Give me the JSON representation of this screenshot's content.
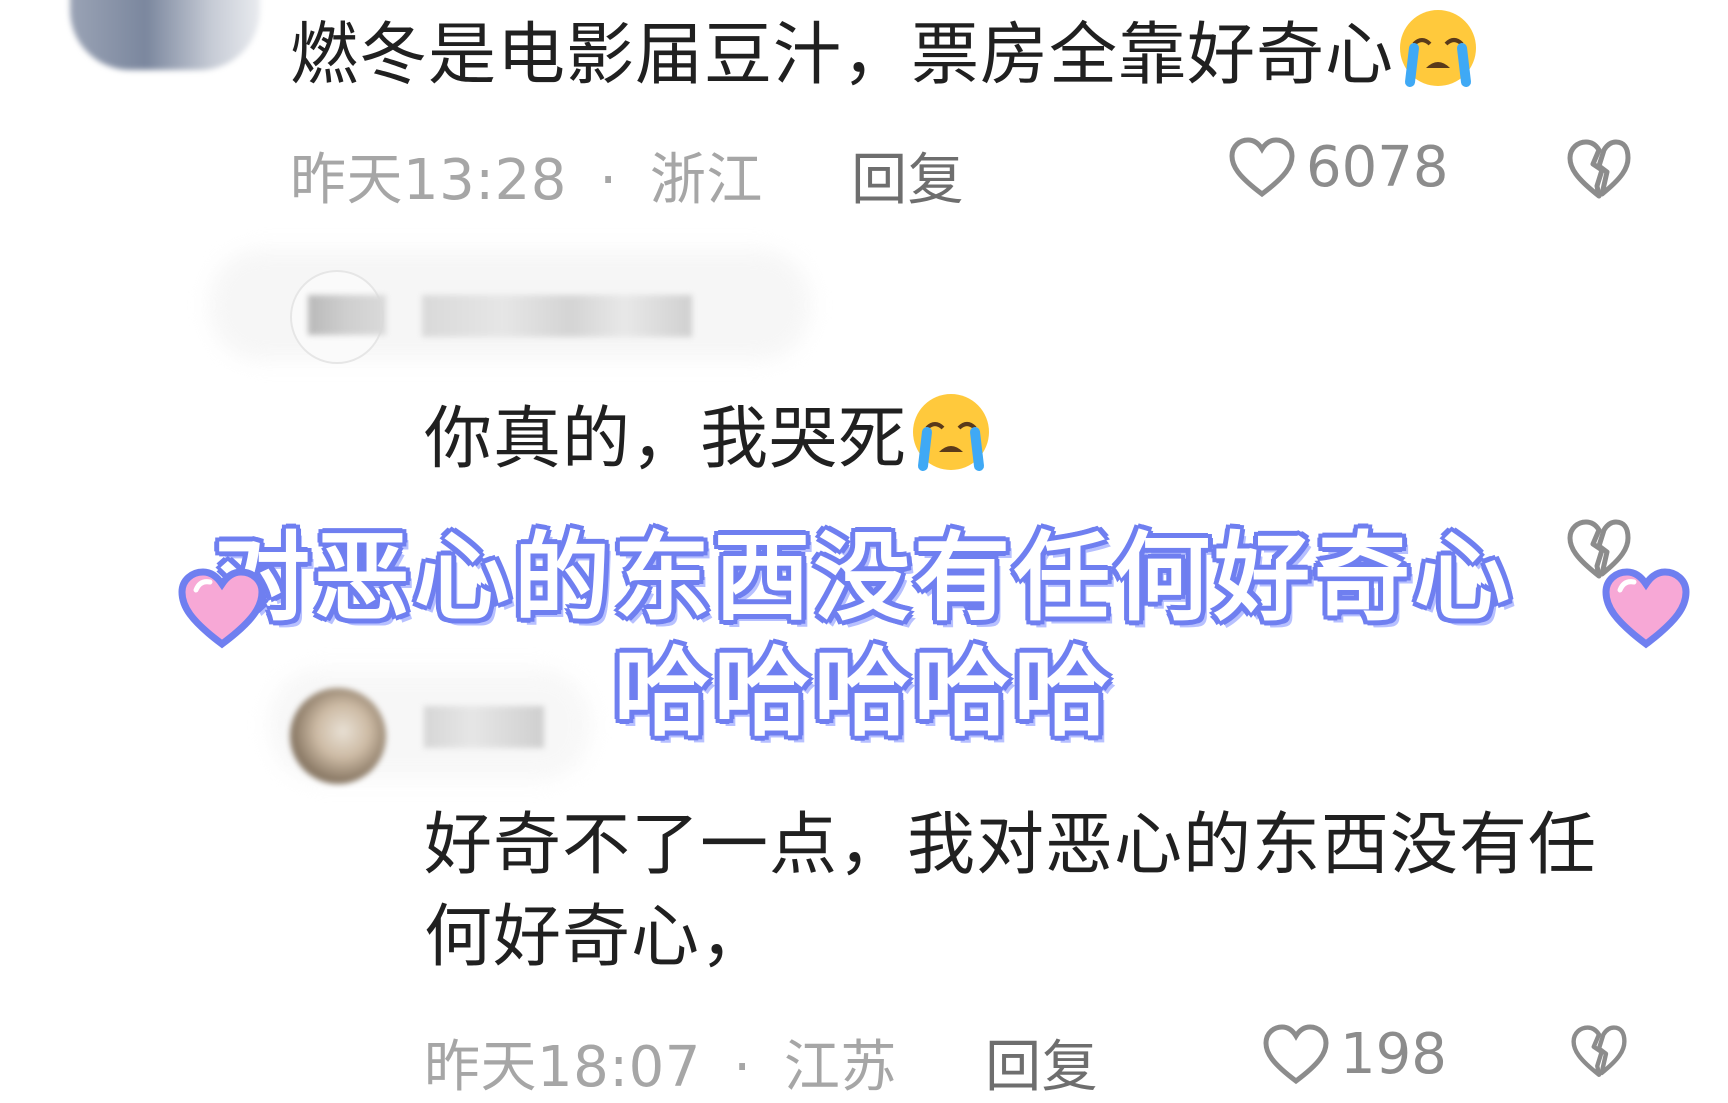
{
  "comments": [
    {
      "text": "燃冬是电影届豆汁，票房全靠好奇心",
      "emoji": "loudly-crying-emoji",
      "time": "昨天13:28",
      "separator": "·",
      "location": "浙江",
      "reply_label": "回复",
      "likes": "6078"
    },
    {
      "text": "你真的，我哭死",
      "emoji": "loudly-crying-emoji"
    },
    {
      "text": "好奇不了一点，我对恶心的东西没有任何好奇心，",
      "time": "昨天18:07",
      "separator": "·",
      "location": "江苏",
      "reply_label": "回复",
      "likes": "198"
    }
  ],
  "overlay": {
    "line1": "对恶心的东西没有任何好奇心",
    "line2": "哈哈哈哈哈"
  },
  "icons": {
    "like": "heart-outline-icon",
    "dislike": "broken-heart-icon",
    "decoration": "pink-heart-icon"
  },
  "colors": {
    "overlay_outline": "#6f7ff0",
    "decor_heart": "#f7a8d6",
    "meta_text": "#a6a6a6"
  }
}
